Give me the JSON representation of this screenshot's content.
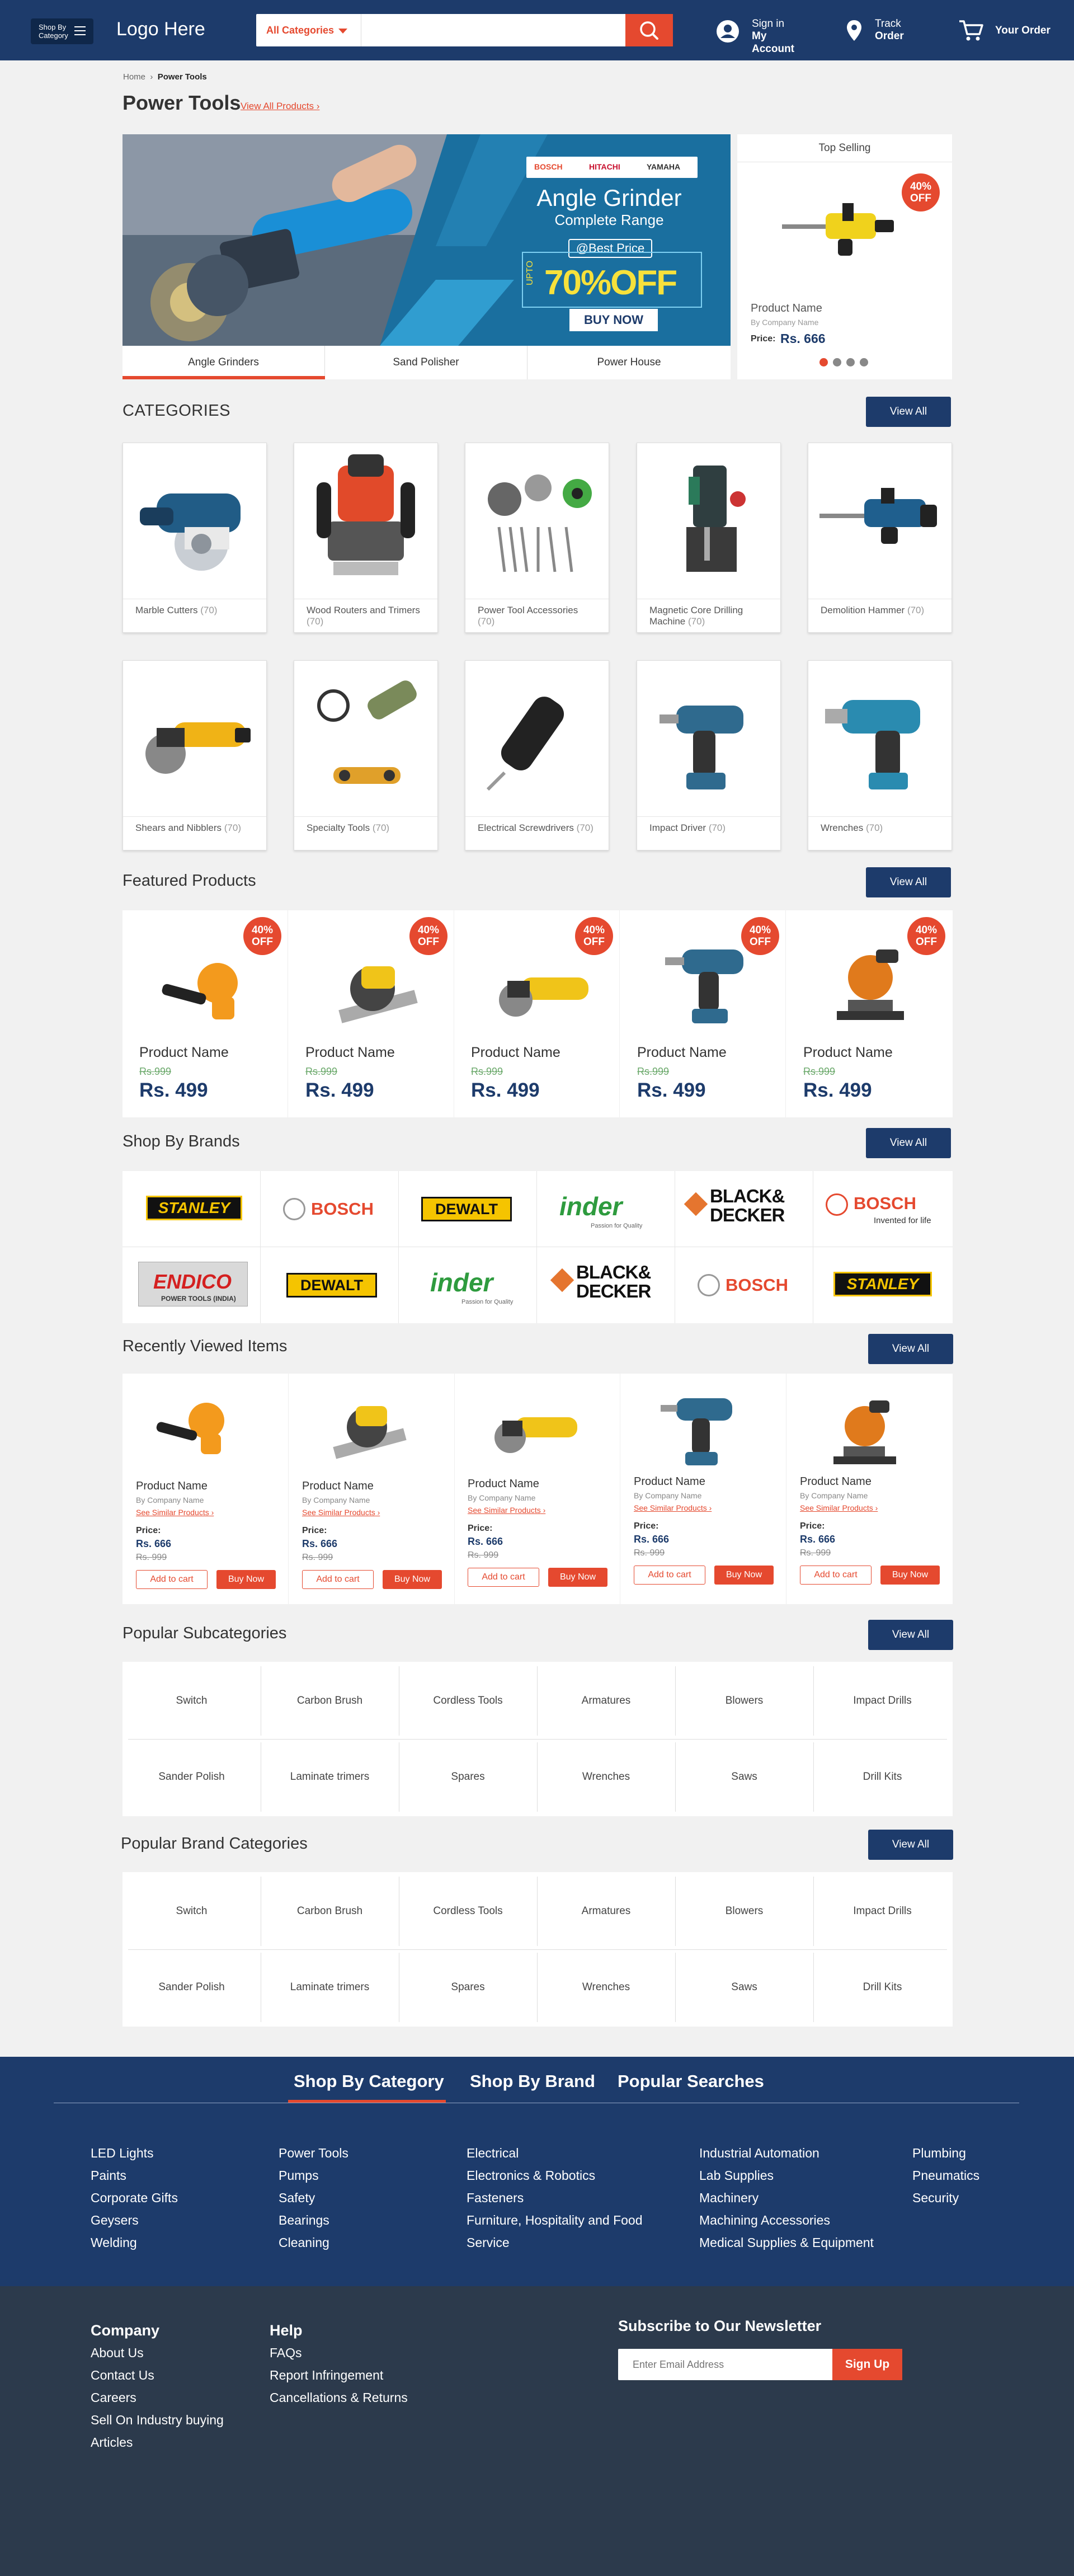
{
  "header": {
    "shop_by_category": "Shop By Category",
    "logo": "Logo Here",
    "category_select": "All Categories",
    "search_placeholder": "",
    "signin_line1": "Sign in",
    "signin_line2": "My Account",
    "track_line1": "Track",
    "track_line2": "Order",
    "your_order": "Your Order"
  },
  "breadcrumb": {
    "home": "Home",
    "current": "Power Tools"
  },
  "page": {
    "title": "Power Tools",
    "view_all_products": "View All Products"
  },
  "hero": {
    "brands": [
      "BOSCH",
      "HITACHI",
      "YAMAHA"
    ],
    "headline": "Angle Grinder",
    "subheadline": "Complete Range",
    "best_price": "@Best Price",
    "upto": "UPTO",
    "discount": "70%OFF",
    "cta": "BUY NOW",
    "tabs": [
      "Angle Grinders",
      "Sand Polisher",
      "Power House"
    ],
    "active_tab": 0
  },
  "top_selling": {
    "heading": "Top Selling",
    "badge_pct": "40%",
    "badge_off": "OFF",
    "product_name": "Product Name",
    "company": "By Company Name",
    "price_label": "Price:",
    "price": "Rs. 666",
    "dots": 4,
    "active_dot": 0
  },
  "categories": {
    "heading": "CATEGORIES",
    "view_all": "View All",
    "items": [
      {
        "name": "Marble Cutters",
        "count": "(70)"
      },
      {
        "name": "Wood Routers and Trimers",
        "count": "(70)"
      },
      {
        "name": "Power Tool Accessories",
        "count": "(70)"
      },
      {
        "name": "Magnetic Core Drilling Machine",
        "count": "(70)"
      },
      {
        "name": "Demolition Hammer",
        "count": "(70)"
      },
      {
        "name": "Shears and Nibblers",
        "count": "(70)"
      },
      {
        "name": "Specialty Tools",
        "count": "(70)"
      },
      {
        "name": "Electrical Screwdrivers",
        "count": "(70)"
      },
      {
        "name": "Impact Driver",
        "count": "(70)"
      },
      {
        "name": "Wrenches",
        "count": "(70)"
      }
    ]
  },
  "featured": {
    "heading": "Featured Products",
    "view_all": "View All",
    "badge_pct": "40%",
    "badge_off": "OFF",
    "items": [
      {
        "name": "Product Name",
        "old_price": "Rs.999",
        "price": "Rs. 499"
      },
      {
        "name": "Product Name",
        "old_price": "Rs.999",
        "price": "Rs. 499"
      },
      {
        "name": "Product Name",
        "old_price": "Rs.999",
        "price": "Rs. 499"
      },
      {
        "name": "Product Name",
        "old_price": "Rs.999",
        "price": "Rs. 499"
      },
      {
        "name": "Product Name",
        "old_price": "Rs.999",
        "price": "Rs. 499"
      }
    ]
  },
  "brands": {
    "heading": "Shop By Brands",
    "view_all": "View All",
    "row1": [
      "STANLEY",
      "BOSCH",
      "DEWALT",
      "inder",
      "BLACK& DECKER",
      "BOSCH"
    ],
    "row2": [
      "ENDICO",
      "DEWALT",
      "inder",
      "BLACK& DECKER",
      "BOSCH",
      "STANLEY"
    ],
    "bosch_tagline": "Invented for life",
    "endico_sub": "POWER TOOLS (INDIA)",
    "inder_sub": "Passion for Quality"
  },
  "recent": {
    "heading": "Recently Viewed Items",
    "view_all": "View All",
    "items": [
      {
        "name": "Product Name",
        "company": "By Company Name",
        "similar": "See Similar Products",
        "price_label": "Price:",
        "price": "Rs. 666",
        "old_price": "Rs. 999",
        "add": "Add to cart",
        "buy": "Buy Now"
      },
      {
        "name": "Product Name",
        "company": "By Company Name",
        "similar": "See Similar Products",
        "price_label": "Price:",
        "price": "Rs. 666",
        "old_price": "Rs. 999",
        "add": "Add to cart",
        "buy": "Buy Now"
      },
      {
        "name": "Product Name",
        "company": "By Company Name",
        "similar": "See Similar Products",
        "price_label": "Price:",
        "price": "Rs. 666",
        "old_price": "Rs. 999",
        "add": "Add to cart",
        "buy": "Buy Now"
      },
      {
        "name": "Product Name",
        "company": "By Company Name",
        "similar": "See Similar Products",
        "price_label": "Price:",
        "price": "Rs. 666",
        "old_price": "Rs. 999",
        "add": "Add to cart",
        "buy": "Buy Now"
      },
      {
        "name": "Product Name",
        "company": "By Company Name",
        "similar": "See Similar Products",
        "price_label": "Price:",
        "price": "Rs. 666",
        "old_price": "Rs. 999",
        "add": "Add to cart",
        "buy": "Buy Now"
      }
    ]
  },
  "subcategories": {
    "heading": "Popular Subcategories",
    "view_all": "View All",
    "items": [
      "Switch",
      "Carbon Brush",
      "Cordless Tools",
      "Armatures",
      "Blowers",
      "Impact Drills",
      "Sander Polish",
      "Laminate trimers",
      "Spares",
      "Wrenches",
      "Saws",
      "Drill Kits"
    ]
  },
  "brand_categories": {
    "heading": "Popular Brand Categories",
    "view_all": "View All",
    "items": [
      "Switch",
      "Carbon Brush",
      "Cordless Tools",
      "Armatures",
      "Blowers",
      "Impact Drills",
      "Sander Polish",
      "Laminate trimers",
      "Spares",
      "Wrenches",
      "Saws",
      "Drill Kits"
    ]
  },
  "footer": {
    "tabs": [
      "Shop By Category",
      "Shop By Brand",
      "Popular Searches"
    ],
    "active_tab": 0,
    "columns": [
      [
        "LED Lights",
        "Paints",
        "Corporate Gifts",
        "Geysers",
        "Welding"
      ],
      [
        "Power Tools",
        "Pumps",
        "Safety",
        "Bearings",
        "Cleaning"
      ],
      [
        "Electrical",
        "Electronics & Robotics",
        "Fasteners",
        "Furniture, Hospitality and Food",
        "Service"
      ],
      [
        "Industrial Automation",
        "Lab Supplies",
        "Machinery",
        "Machining Accessories",
        "Medical Supplies & Equipment"
      ],
      [
        "Plumbing",
        "Pneumatics",
        "Security"
      ]
    ],
    "company_heading": "Company",
    "company_links": [
      "About Us",
      "Contact Us",
      "Careers",
      "Sell On Industry buying",
      "Articles"
    ],
    "help_heading": "Help",
    "help_links": [
      "FAQs",
      "Report Infringement",
      "Cancellations & Returns"
    ],
    "newsletter_heading": "Subscribe to Our Newsletter",
    "newsletter_placeholder": "Enter Email Address",
    "signup": "Sign Up"
  },
  "colors": {
    "navy": "#1d3b6b",
    "accent": "#e5492f",
    "footer_dark": "#2c3a4c"
  }
}
